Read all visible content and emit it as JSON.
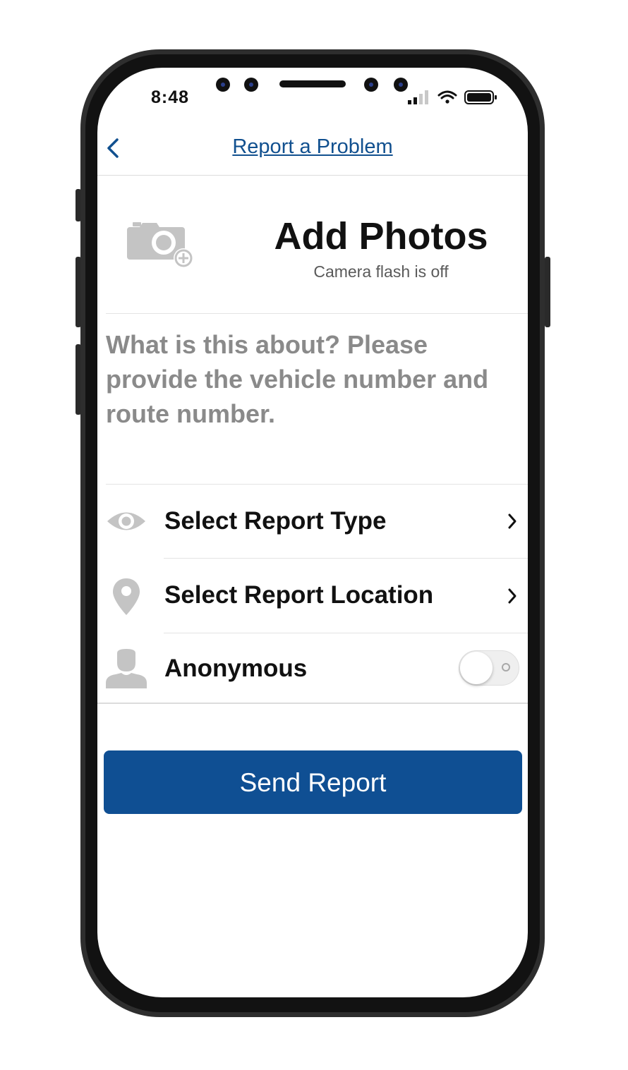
{
  "status_bar": {
    "time": "8:48"
  },
  "nav": {
    "back_icon": "chevron-left-icon",
    "title": "Report a Problem"
  },
  "photos": {
    "icon": "camera-add-icon",
    "title": "Add Photos",
    "flash_status": "Camera flash is off"
  },
  "description": {
    "placeholder": "What is this about?  Please provide the vehicle number and route number."
  },
  "options": {
    "report_type": {
      "icon": "eye-icon",
      "label": "Select Report Type"
    },
    "report_location": {
      "icon": "location-pin-icon",
      "label": "Select Report Location"
    },
    "anonymous": {
      "icon": "person-icon",
      "label": "Anonymous",
      "enabled": false
    }
  },
  "send_button": {
    "label": "Send Report"
  },
  "colors": {
    "accent": "#0f4f93",
    "icon_gray": "#c4c4c4",
    "placeholder_gray": "#8a8a8a"
  }
}
